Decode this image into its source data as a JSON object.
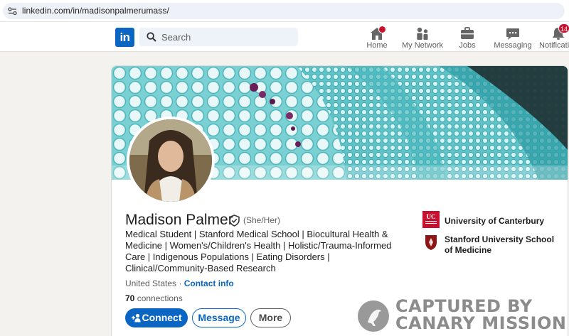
{
  "browser": {
    "url": "linkedin.com/in/madisonpalmerumass/",
    "site_icon": "site-settings-icon"
  },
  "nav": {
    "logo_text": "in",
    "search_placeholder": "Search",
    "items": [
      {
        "label": "Home",
        "icon": "home-icon",
        "badge": ""
      },
      {
        "label": "My Network",
        "icon": "network-icon",
        "badge": ""
      },
      {
        "label": "Jobs",
        "icon": "briefcase-icon",
        "badge": ""
      },
      {
        "label": "Messaging",
        "icon": "chat-icon",
        "badge": ""
      },
      {
        "label": "Notificati",
        "icon": "bell-icon",
        "badge": "14"
      }
    ]
  },
  "profile": {
    "name": "Madison Palmer",
    "pronouns": "(She/Her)",
    "headline": "Medical Student | Stanford Medical School | Biocultural Health & Medicine | Women's/Children's Health | Holistic/Trauma-Informed Care | Indigenous Populations | Eating Disorders | Clinical/Community-Based Research",
    "location": "United States",
    "location_separator": "·",
    "contact_info": "Contact info",
    "connections_count": "70",
    "connections_label": "connections",
    "buttons": {
      "connect": "Connect",
      "message": "Message",
      "more": "More"
    },
    "education": [
      {
        "name": "University of Canterbury",
        "logo": "uc-logo"
      },
      {
        "name": "Stanford University School of Medicine",
        "logo": "stanford-shield-logo"
      }
    ]
  },
  "watermark": {
    "line1": "CAPTURED BY",
    "line2": "CANARY MISSION"
  },
  "colors": {
    "brand": "#0a66c2",
    "badge": "#cb112d",
    "page_bg": "#f4f2ee",
    "banner_teal": "#5fc9cc"
  }
}
